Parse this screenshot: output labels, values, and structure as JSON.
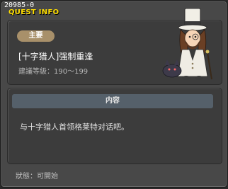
{
  "window": {
    "quest_id": "20985-0",
    "title": "QUEST INFO"
  },
  "quest": {
    "tag": "主要",
    "name": "[十字猎人]强制重逢",
    "level": "建議等級：190～199",
    "content_header": "内容",
    "content_text": "与十字猎人首领格莱特对话吧。"
  },
  "status": "狀態：可開始",
  "colors": {
    "title": "#ffde00",
    "tag_bg": "#a8906a",
    "content_header_bg": "#55606a",
    "window_bg": "#484848",
    "panel_bg": "#3c3c3c"
  }
}
